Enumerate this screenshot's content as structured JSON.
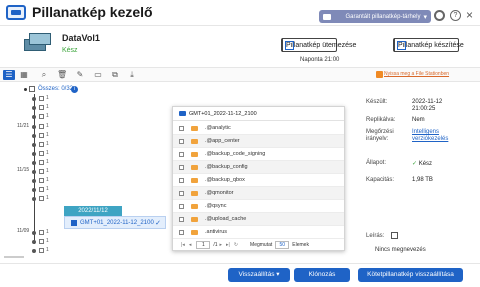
{
  "app": {
    "title": "Pillanatkép kezelő",
    "storage_label": "Garantált pillanatkép-tárhely",
    "close_glyph": "×",
    "help_glyph": "?"
  },
  "volume": {
    "name": "DataVol1",
    "status": "Kész"
  },
  "actions": {
    "schedule_label": "Pillanatkép ütemezése",
    "schedule_sub": "Naponta 21:00",
    "take_snapshot_label": "Pillanatkép készítése"
  },
  "toolbar": {
    "file_station_link": "Nyissa meg a File Stationben"
  },
  "timeline": {
    "overview_label": "Összes: 0/32",
    "rows_count_label": "1",
    "dates": [
      "11/21",
      "11/15",
      "11/09"
    ],
    "selected_date": "2022/11/12",
    "selected_snapshot": "GMT+01_2022-11-12_2100"
  },
  "browser": {
    "path": "GMT+01_2022-11-12_2100",
    "items": [
      ".@analytic",
      ".@app_center",
      ".@backup_code_signing",
      ".@backup_config",
      ".@backup_qbox",
      ".@qmonitor",
      ".@qsync",
      ".@upload_cache",
      ".antivirus"
    ],
    "page_value": "1",
    "page_total": "/1",
    "show_label": "Megmutat",
    "per_page": "50",
    "items_label": "Elemek"
  },
  "details": {
    "created_label": "Készült:",
    "created_value_1": "2022-11-12",
    "created_value_2": "21:00:25",
    "replicated_label": "Replikálva:",
    "replicated_value": "Nem",
    "retention_label_1": "Megőrzési",
    "retention_label_2": "irányelv:",
    "retention_value_1": "Intelligens",
    "retention_value_2": "verziókezelés",
    "status_label": "Állapot:",
    "status_value": "Kész",
    "capacity_label": "Kapacitás:",
    "capacity_value": "1,98 TB",
    "note_label": "Leírás:",
    "note_value": "Nincs megnevezés"
  },
  "footer": {
    "restore_label": "Visszaállítás",
    "clone_label": "Klónozás",
    "revert_label": "Kötetpillanatkép visszaállítása"
  },
  "colors": {
    "accent": "#1f63c6",
    "success": "#3aa43a",
    "folder": "#f1a33c"
  }
}
